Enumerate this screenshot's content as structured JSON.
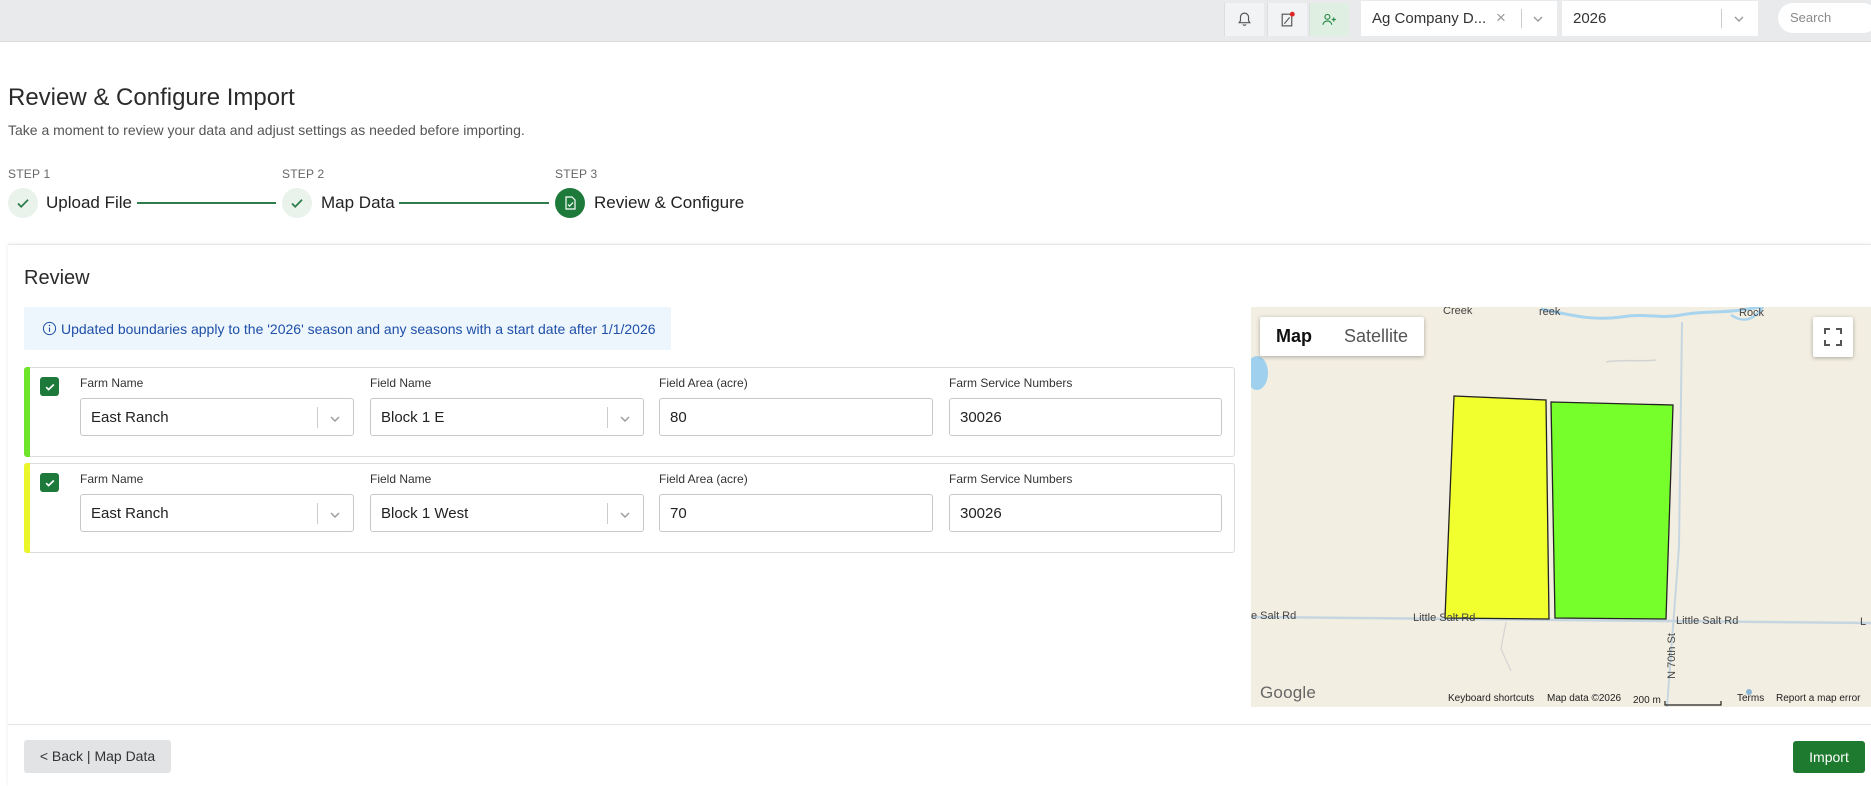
{
  "topbar": {
    "company_value": "Ag Company D...",
    "season_value": "2026",
    "search_placeholder": "Search"
  },
  "header": {
    "title": "Review & Configure Import",
    "subtitle": "Take a moment to review your data and adjust settings as needed before importing."
  },
  "stepper": {
    "steps": [
      {
        "label": "STEP 1",
        "title": "Upload File",
        "state": "complete"
      },
      {
        "label": "STEP 2",
        "title": "Map Data",
        "state": "complete"
      },
      {
        "label": "STEP 3",
        "title": "Review & Configure",
        "state": "active"
      }
    ]
  },
  "review": {
    "title": "Review",
    "info": "Updated boundaries apply to the '2026' season and any seasons with a start date after 1/1/2026",
    "labels": {
      "farm_name": "Farm Name",
      "field_name": "Field Name",
      "field_area": "Field Area (acre)",
      "fsn": "Farm Service Numbers"
    },
    "rows": [
      {
        "checked": true,
        "color": "#6ee52a",
        "farm_name": "East Ranch",
        "field_name": "Block 1 E",
        "field_area": "80",
        "fsn": "30026"
      },
      {
        "checked": true,
        "color": "#eaf52a",
        "farm_name": "East Ranch",
        "field_name": "Block 1 West",
        "field_area": "70",
        "fsn": "30026"
      }
    ]
  },
  "map": {
    "type_map": "Map",
    "type_satellite": "Satellite",
    "selected_type": "Map",
    "road_left": "e Salt Rd",
    "road_mid": "Little Salt Rd",
    "road_right": "Little Salt Rd",
    "road_right_cut": "L",
    "street": "N 70th St",
    "label_creek": "Creek",
    "label_reek": "reek",
    "label_rock": "Rock",
    "google": "Google",
    "keyboard": "Keyboard shortcuts",
    "mapdata": "Map data ©2026",
    "scale": "200 m",
    "terms": "Terms",
    "report": "Report a map error",
    "field_colors": {
      "west": "#f2ff2e",
      "east": "#76ff2a"
    }
  },
  "footer": {
    "back": "< Back | Map Data",
    "import": "Import"
  }
}
